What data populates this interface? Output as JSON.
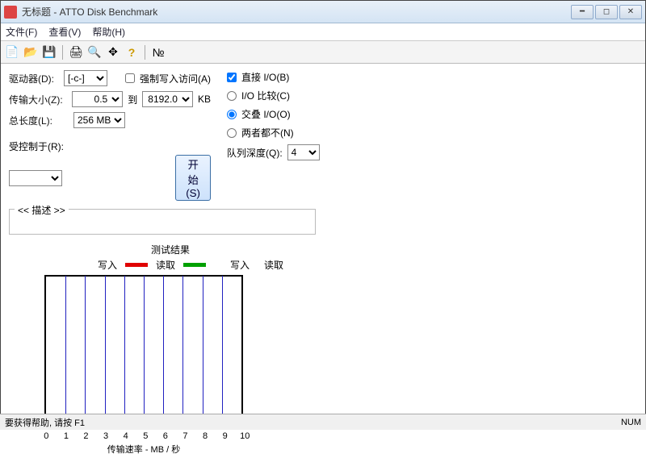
{
  "window": {
    "title": "无标题 - ATTO Disk Benchmark"
  },
  "menu": {
    "file": "文件(F)",
    "view": "查看(V)",
    "help": "帮助(H)"
  },
  "labels": {
    "drive": "驱动器(D):",
    "transfer": "传输大小(Z):",
    "to": "到",
    "kb": "KB",
    "length": "总长度(L):",
    "force_write": "强制写入访问(A)",
    "direct_io": "直接 I/O(B)",
    "io_compare": "I/O 比较(C)",
    "overlap_io": "交叠 I/O(O)",
    "neither": "两者都不(N)",
    "queue_depth": "队列深度(Q):",
    "controlled": "受控制于(R):",
    "start": "开始(S)",
    "desc": "<< 描述 >>",
    "result": "测试结果",
    "write": "写入",
    "read": "读取",
    "xaxis": "传输速率 - MB / 秒",
    "status": "要获得帮助, 请按 F1",
    "num": "NUM"
  },
  "values": {
    "drive": "[-c-]",
    "size_from": "0.5",
    "size_to": "8192.0",
    "length": "256 MB",
    "queue": "4"
  },
  "chart_data": {
    "type": "bar",
    "categories": [],
    "values": [],
    "title": "测试结果",
    "xlabel": "传输速率 - MB / 秒",
    "ylabel": "",
    "xlim": [
      0,
      10
    ],
    "xticks": [
      0,
      1,
      2,
      3,
      4,
      5,
      6,
      7,
      8,
      9,
      10
    ],
    "series": [
      {
        "name": "写入",
        "color": "#e00000",
        "values": []
      },
      {
        "name": "读取",
        "color": "#00a000",
        "values": []
      }
    ]
  }
}
